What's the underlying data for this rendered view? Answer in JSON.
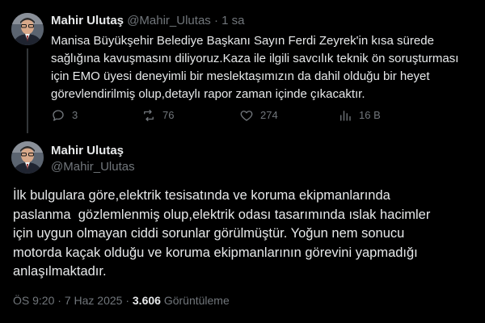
{
  "tweet1": {
    "author_name": "Mahir Ulutaş",
    "author_handle": "@Mahir_Ulutas",
    "separator": "·",
    "time": "1 sa",
    "lines": [
      "Manisa Büyükşehir Belediye Başkanı Sayın Ferdi Zeyrek'in kısa sürede",
      "sağlığına kavuşmasını diliyoruz.Kaza ile ilgili savcılık teknik ön soruşturması",
      "için EMO üyesi deneyimli bir meslektaşımızın da dahil olduğu bir heyet",
      "görevlendirilmiş olup,detaylı rapor zaman içinde çıkacaktır."
    ],
    "actions": {
      "replies": "3",
      "reposts": "76",
      "likes": "274",
      "views": "16 B"
    }
  },
  "tweet2": {
    "author_name": "Mahir Ulutaş",
    "author_handle": "@Mahir_Ulutas",
    "lines": [
      "İlk bulgulara göre,elektrik tesisatında ve koruma ekipmanlarında",
      "paslanma  gözlemlenmiş olup,elektrik odası tasarımında ıslak hacimler",
      "için uygun olmayan ciddi sorunlar görülmüştür. Yoğun nem sonucu",
      "motorda kaçak olduğu ve koruma ekipmanlarının görevini yapmadığı",
      "anlaşılmaktadır."
    ],
    "time": "ÖS 9:20",
    "separator": "·",
    "date": "7 Haz 2025",
    "views_count": "3.606",
    "views_label": "Görüntüleme"
  },
  "icons": {
    "reply": "reply-icon",
    "repost": "repost-icon",
    "like": "heart-icon",
    "views": "views-icon"
  },
  "colors": {
    "background": "#000000",
    "text": "#e7e9ea",
    "muted": "#71767b",
    "divider": "#333639"
  }
}
